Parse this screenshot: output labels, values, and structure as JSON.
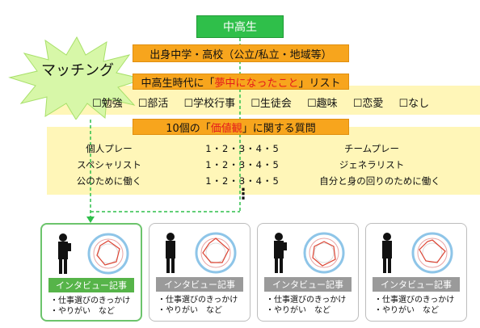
{
  "header": {
    "title": "中高生"
  },
  "burst": {
    "label": "マッチング"
  },
  "box1": {
    "label": "出身中学・高校（公立/私立・地域等）"
  },
  "box2": {
    "prefix": "中高生時代に「",
    "highlight": "夢中になったこと",
    "suffix": "」リスト"
  },
  "checklist": [
    "☐勉強",
    "☐部活",
    "☐学校行事",
    "☐生徒会",
    "☐趣味",
    "☐恋愛",
    "☐なし"
  ],
  "box3": {
    "prefix": "10個の「",
    "highlight": "価値観",
    "suffix": "」に関する質問"
  },
  "questions": [
    {
      "left": "個人プレー",
      "scale": "1・2・3・4・5",
      "right": "チームプレー"
    },
    {
      "left": "スペシャリスト",
      "scale": "1・2・3・4・5",
      "right": "ジェネラリスト"
    },
    {
      "left": "公のために働く",
      "scale": "1・2・3・4・5",
      "right": "自分と身の回りのために働く"
    }
  ],
  "ellipsis": "⋮",
  "cards": [
    {
      "title": "インタビュー記事",
      "bullets": [
        "・仕事選びのきっかけ",
        "・やりがい　など"
      ]
    },
    {
      "title": "インタビュー記事",
      "bullets": [
        "・仕事選びのきっかけ",
        "・やりがい　など"
      ]
    },
    {
      "title": "インタビュー記事",
      "bullets": [
        "・仕事選びのきっかけ",
        "・やりがい　など"
      ]
    },
    {
      "title": "インタビュー記事",
      "bullets": [
        "・仕事選びのきっかけ",
        "・やりがい　など"
      ]
    }
  ],
  "colors": {
    "green": "#2fbf4a",
    "orange": "#f7a51d",
    "pale_yellow": "#fff6b8",
    "highlight_red": "#e41b1b"
  }
}
